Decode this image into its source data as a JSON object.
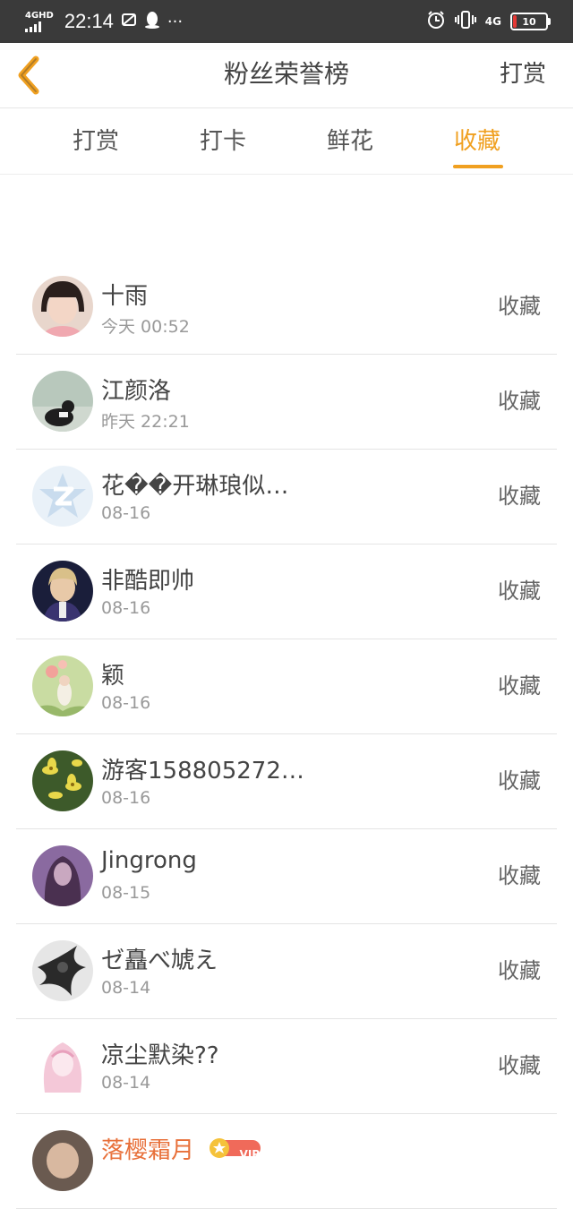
{
  "status_bar": {
    "network_tag": "4GHD",
    "time": "22:14",
    "notif_icons": [
      "mute-icon",
      "qq-penguin-icon"
    ],
    "more": "···",
    "mobile_tag": "4G",
    "battery": "10"
  },
  "header": {
    "title": "粉丝荣誉榜",
    "action": "打赏"
  },
  "tabs": [
    {
      "label": "打赏"
    },
    {
      "label": "打卡"
    },
    {
      "label": "鲜花"
    },
    {
      "label": "收藏"
    }
  ],
  "active_tab": "收藏",
  "accent_color": "#f0a020",
  "rows": [
    {
      "name": "十雨",
      "date": "今天 00:52",
      "badge": "收藏"
    },
    {
      "name": "江颜洛",
      "date": "昨天 22:21",
      "badge": "收藏"
    },
    {
      "name": "花��开琳琅似…",
      "date": "08-16",
      "badge": "收藏"
    },
    {
      "name": "非酷即帅",
      "date": "08-16",
      "badge": "收藏"
    },
    {
      "name": "颖",
      "date": "08-16",
      "badge": "收藏"
    },
    {
      "name": "游客158805272…",
      "date": "08-16",
      "badge": "收藏"
    },
    {
      "name": "Jingrong",
      "date": "08-15",
      "badge": "收藏"
    },
    {
      "name": "ゼ矗べ虓え",
      "date": "08-14",
      "badge": "收藏"
    },
    {
      "name": "凉尘默染??",
      "date": "08-14",
      "badge": "收藏"
    }
  ],
  "partial_row": {
    "name": "落樱霜月",
    "vip": "VIP"
  }
}
